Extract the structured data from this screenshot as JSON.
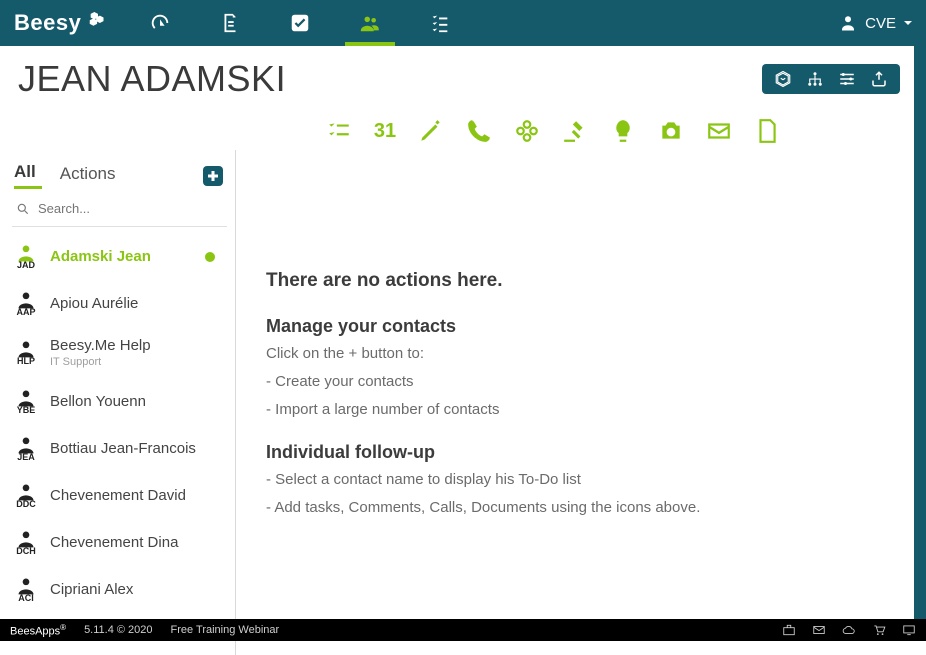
{
  "brand": "Beesy",
  "user": {
    "label": "CVE"
  },
  "page": {
    "title": "JEAN ADAMSKI"
  },
  "tools": {
    "box": "box-icon",
    "fork": "fork-icon",
    "sliders": "sliders-icon",
    "export": "export-icon"
  },
  "strip": {
    "date_num": "31"
  },
  "sidebar": {
    "tab_all": "All",
    "tab_actions": "Actions",
    "search_placeholder": "Search...",
    "contacts": [
      {
        "ini": "JAD",
        "name": "Adamski Jean",
        "active": true,
        "presence": true
      },
      {
        "ini": "AAP",
        "name": "Apiou Aurélie"
      },
      {
        "ini": "HLP",
        "name": "Beesy.Me Help",
        "sub": "IT Support"
      },
      {
        "ini": "YBE",
        "name": "Bellon Youenn"
      },
      {
        "ini": "JEA",
        "name": "Bottiau Jean-Francois"
      },
      {
        "ini": "DDC",
        "name": "Chevenement David"
      },
      {
        "ini": "DCH",
        "name": "Chevenement Dina"
      },
      {
        "ini": "ACI",
        "name": "Cipriani Alex"
      }
    ]
  },
  "content": {
    "empty_heading": "There are no actions here.",
    "section1_title": "Manage your contacts",
    "section1_lines": [
      "Click on the + button to:",
      "- Create your contacts",
      "- Import a large number of contacts"
    ],
    "section2_title": "Individual follow-up",
    "section2_lines": [
      "- Select a contact name to display his To-Do list",
      "- Add tasks, Comments, Calls, Documents using the icons above."
    ]
  },
  "footer": {
    "logo": "BeesApps",
    "version": "5.11.4 © 2020",
    "webinar": "Free Training Webinar"
  }
}
